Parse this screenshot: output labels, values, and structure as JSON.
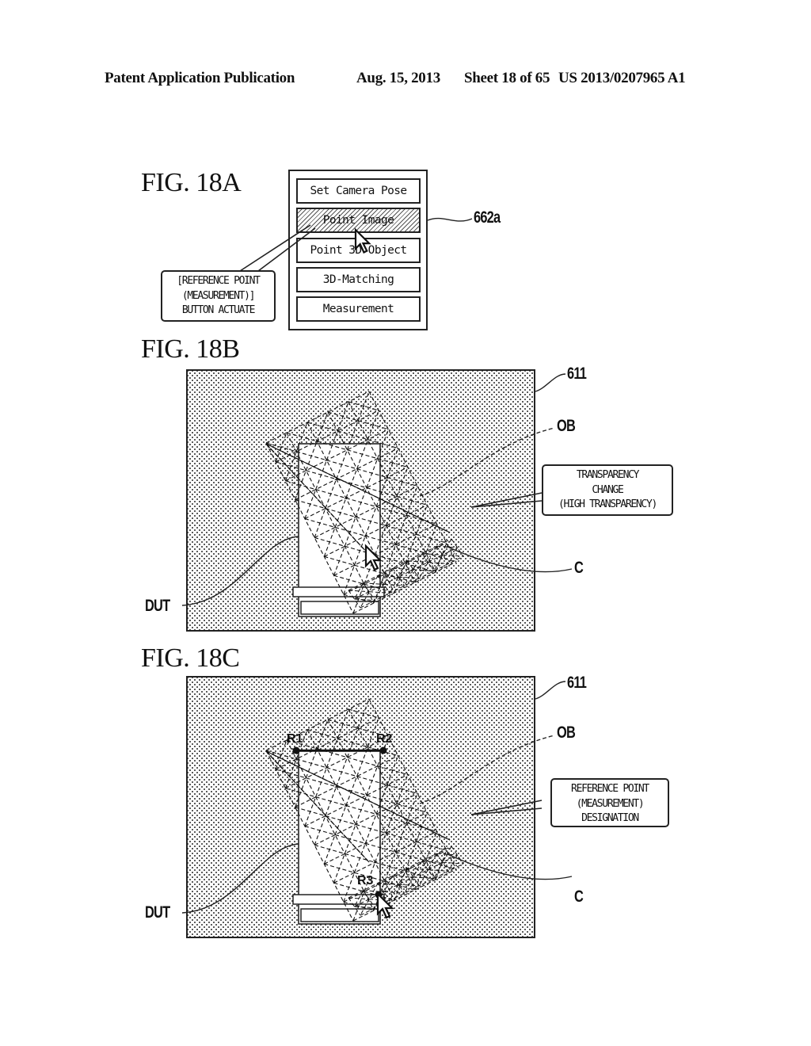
{
  "header": {
    "publication": "Patent Application Publication",
    "date": "Aug. 15, 2013",
    "sheet": "Sheet 18 of 65",
    "patent_number": "US 2013/0207965 A1"
  },
  "fig18a": {
    "label": "FIG. 18A",
    "menu_buttons": [
      {
        "label": "Set Camera Pose",
        "selected": false
      },
      {
        "label": "Point Image",
        "selected": true
      },
      {
        "label": "Point 3D Object",
        "selected": false
      },
      {
        "label": "3D-Matching",
        "selected": false
      },
      {
        "label": "Measurement",
        "selected": false
      }
    ],
    "callout_lines": [
      "[REFERENCE POINT",
      "(MEASUREMENT)]",
      "BUTTON ACTUATE"
    ],
    "ref_selected_button": "662a"
  },
  "fig18b": {
    "label": "FIG. 18B",
    "ref_screen": "611",
    "ref_object": "OB",
    "ref_cursor": "C",
    "ref_dut": "DUT",
    "callout_lines": [
      "TRANSPARENCY",
      "CHANGE",
      "(HIGH TRANSPARENCY)"
    ]
  },
  "fig18c": {
    "label": "FIG. 18C",
    "ref_screen": "611",
    "ref_object": "OB",
    "ref_cursor": "C",
    "ref_dut": "DUT",
    "reference_points": [
      "R1",
      "R2",
      "R3"
    ],
    "callout_lines": [
      "REFERENCE POINT",
      "(MEASUREMENT)",
      "DESIGNATION"
    ]
  },
  "icons": {
    "cursor": "mouse-pointer-arrow",
    "marker": "reference-point-dot"
  }
}
